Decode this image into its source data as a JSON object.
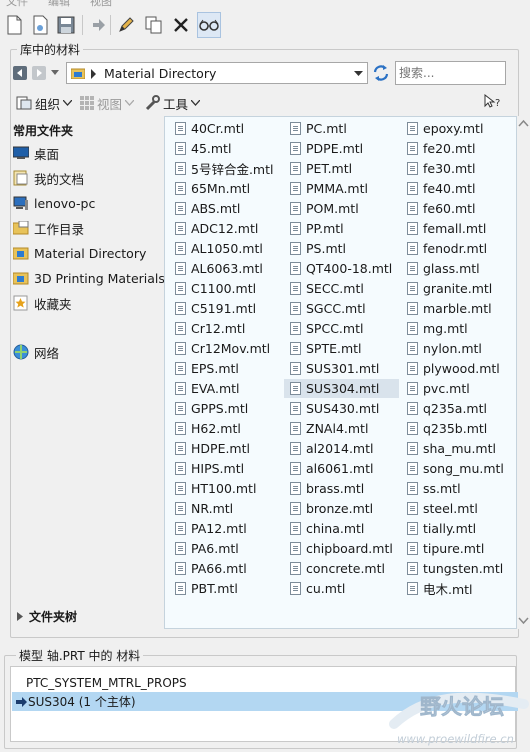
{
  "menu": [
    "文件",
    "编辑",
    "视图"
  ],
  "toolbar": {
    "buttons": [
      "new-file",
      "new-from-template",
      "save",
      "forward",
      "edit",
      "copy",
      "delete",
      "view"
    ]
  },
  "library_group": {
    "title": "库中的材料"
  },
  "address": {
    "path": "Material Directory",
    "search_placeholder": "搜索..."
  },
  "commands": {
    "organize": "组织",
    "views": "视图",
    "tools": "工具"
  },
  "sidebar": {
    "favorites_header": "常用文件夹",
    "items": [
      {
        "label": "桌面",
        "icon": "desktop-icon"
      },
      {
        "label": "我的文档",
        "icon": "documents-icon"
      },
      {
        "label": "lenovo-pc",
        "icon": "computer-icon"
      },
      {
        "label": "工作目录",
        "icon": "working-dir-icon"
      },
      {
        "label": "Material Directory",
        "icon": "folder-icon"
      },
      {
        "label": "3D Printing Materials",
        "icon": "folder-icon"
      },
      {
        "label": "收藏夹",
        "icon": "favorites-icon"
      },
      {
        "label": "网络",
        "icon": "network-icon"
      }
    ],
    "folder_tree": "文件夹树"
  },
  "files": {
    "col1": [
      "40Cr.mtl",
      "45.mtl",
      "5号锌合金.mtl",
      "65Mn.mtl",
      "ABS.mtl",
      "ADC12.mtl",
      "AL1050.mtl",
      "AL6063.mtl",
      "C1100.mtl",
      "C5191.mtl",
      "Cr12.mtl",
      "Cr12Mov.mtl",
      "EPS.mtl",
      "EVA.mtl",
      "GPPS.mtl",
      "H62.mtl",
      "HDPE.mtl",
      "HIPS.mtl",
      "HT100.mtl",
      "NR.mtl",
      "PA12.mtl",
      "PA6.mtl",
      "PA66.mtl",
      "PBT.mtl"
    ],
    "col2": [
      "PC.mtl",
      "PDPE.mtl",
      "PET.mtl",
      "PMMA.mtl",
      "POM.mtl",
      "PP.mtl",
      "PS.mtl",
      "QT400-18.mtl",
      "SECC.mtl",
      "SGCC.mtl",
      "SPCC.mtl",
      "SPTE.mtl",
      "SUS301.mtl",
      "SUS304.mtl",
      "SUS430.mtl",
      "ZNAl4.mtl",
      "al2014.mtl",
      "al6061.mtl",
      "brass.mtl",
      "bronze.mtl",
      "china.mtl",
      "chipboard.mtl",
      "concrete.mtl",
      "cu.mtl"
    ],
    "col3": [
      "epoxy.mtl",
      "fe20.mtl",
      "fe30.mtl",
      "fe40.mtl",
      "fe60.mtl",
      "femall.mtl",
      "fenodr.mtl",
      "glass.mtl",
      "granite.mtl",
      "marble.mtl",
      "mg.mtl",
      "nylon.mtl",
      "plywood.mtl",
      "pvc.mtl",
      "q235a.mtl",
      "q235b.mtl",
      "sha_mu.mtl",
      "song_mu.mtl",
      "ss.mtl",
      "steel.mtl",
      "tially.mtl",
      "tipure.mtl",
      "tungsten.mtl",
      "电木.mtl"
    ],
    "selected": "SUS304.mtl"
  },
  "model_group": {
    "title": "模型 轴.PRT 中的 材料",
    "rows": [
      "PTC_SYSTEM_MTRL_PROPS",
      "SUS304 (1 个主体)"
    ]
  },
  "watermark": {
    "title": "野火论坛",
    "url": "www.proewildfire.cn"
  },
  "colors": {
    "selection": "#b3d7f2",
    "list_bg": "#f5fbfe",
    "accent": "#2b71c4"
  }
}
